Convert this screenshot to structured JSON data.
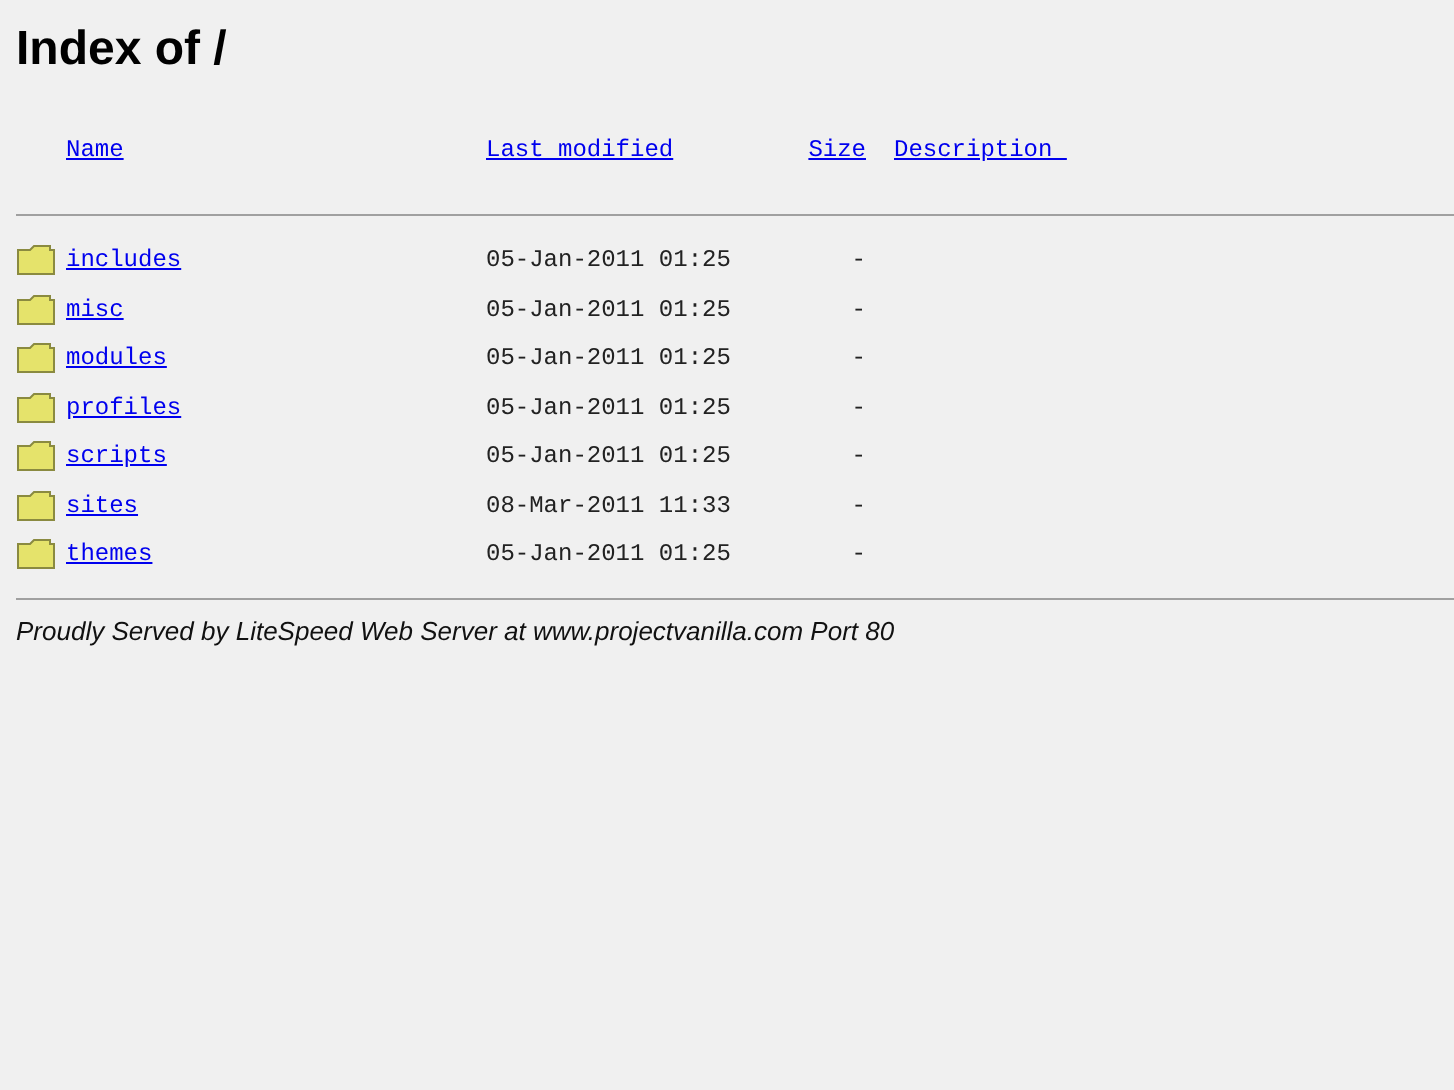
{
  "title": "Index of /",
  "columns": {
    "name": "Name",
    "modified": "Last modified",
    "size": "Size",
    "description": "Description "
  },
  "rows": [
    {
      "name": "includes",
      "modified": "05-Jan-2011 01:25",
      "size": "-"
    },
    {
      "name": "misc",
      "modified": "05-Jan-2011 01:25",
      "size": "-"
    },
    {
      "name": "modules",
      "modified": "05-Jan-2011 01:25",
      "size": "-"
    },
    {
      "name": "profiles",
      "modified": "05-Jan-2011 01:25",
      "size": "-"
    },
    {
      "name": "scripts",
      "modified": "05-Jan-2011 01:25",
      "size": "-"
    },
    {
      "name": "sites",
      "modified": "08-Mar-2011 11:33",
      "size": "-"
    },
    {
      "name": "themes",
      "modified": "05-Jan-2011 01:25",
      "size": "-"
    }
  ],
  "footer": "Proudly Served by LiteSpeed Web Server at www.projectvanilla.com Port 80"
}
